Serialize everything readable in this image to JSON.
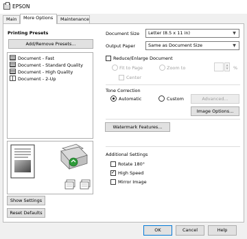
{
  "window": {
    "title": "EPSON"
  },
  "tabs": [
    {
      "label": "Main"
    },
    {
      "label": "More Options"
    },
    {
      "label": "Maintenance"
    }
  ],
  "presets": {
    "heading": "Printing Presets",
    "add_remove_label": "Add/Remove Presets...",
    "items": [
      {
        "label": "Document - Fast"
      },
      {
        "label": "Document - Standard Quality"
      },
      {
        "label": "Document - High Quality"
      },
      {
        "label": "Document - 2-Up"
      }
    ]
  },
  "document": {
    "size_label": "Document Size",
    "size_value": "Letter (8.5 x 11 in)",
    "output_label": "Output Paper",
    "output_value": "Same as Document Size",
    "reduce_label": "Reduce/Enlarge Document",
    "fit_label": "Fit to Page",
    "zoom_label": "Zoom to",
    "percent": "%",
    "center_label": "Center"
  },
  "tone": {
    "heading": "Tone Correction",
    "automatic_label": "Automatic",
    "custom_label": "Custom",
    "advanced_label": "Advanced...",
    "image_options_label": "Image Options..."
  },
  "watermark": {
    "label": "Watermark Features..."
  },
  "additional": {
    "heading": "Additional Settings",
    "rotate_label": "Rotate 180°",
    "high_speed_label": "High Speed",
    "mirror_label": "Mirror Image"
  },
  "left_buttons": {
    "show_settings": "Show Settings",
    "reset_defaults": "Reset Defaults"
  },
  "dialog_buttons": {
    "ok": "OK",
    "cancel": "Cancel",
    "help": "Help"
  },
  "colors": {
    "accent": "#0078d7",
    "printer_arrow": "#2e9b3a"
  }
}
